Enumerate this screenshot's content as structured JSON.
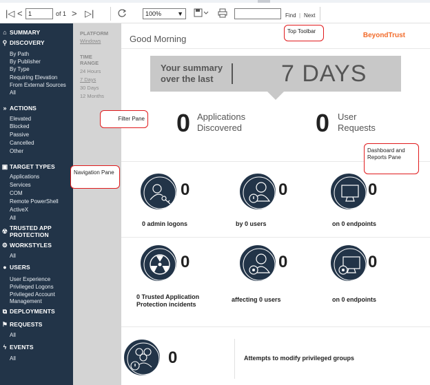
{
  "toolbar": {
    "first_page": "|◁",
    "prev_page": "<",
    "page_value": "1",
    "of_label": "of 1",
    "next_page": ">",
    "last_page": "▷|",
    "zoom_value": "100%",
    "find_label": "Find",
    "separator": "|",
    "next_label": "Next"
  },
  "sidebar": {
    "summary": "SUMMARY",
    "discovery": {
      "title": "DISCOVERY",
      "items": [
        "By Path",
        "By Publisher",
        "By Type",
        "Requiring Elevation",
        "From External Sources",
        "All"
      ]
    },
    "actions": {
      "title": "ACTIONS",
      "items": [
        "Elevated",
        "Blocked",
        "Passive",
        "Cancelled",
        "Other"
      ]
    },
    "target_types": {
      "title": "TARGET TYPES",
      "items": [
        "Applications",
        "Services",
        "COM",
        "Remote PowerShell",
        "ActiveX",
        "All"
      ]
    },
    "trusted_app": "TRUSTED APP PROTECTION",
    "workstyles": {
      "title": "WORKSTYLES",
      "items": [
        "All"
      ]
    },
    "users": {
      "title": "USERS",
      "items": [
        "User Experience",
        "Privileged Logons",
        "Privileged Account Management"
      ]
    },
    "deployments": "DEPLOYMENTS",
    "requests": {
      "title": "REQUESTS",
      "items": [
        "All"
      ]
    },
    "events": {
      "title": "EVENTS",
      "items": [
        "All"
      ]
    }
  },
  "filter": {
    "platform_label": "PLATFORM",
    "platform_value": "Windows",
    "time_range_label": "TIME RANGE",
    "time_options": [
      "24 Hours",
      "7 Days",
      "30 Days",
      "12 Months"
    ]
  },
  "main": {
    "greeting": "Good Morning",
    "brand": "BeyondTrust",
    "summary_label": "Your summary over the last",
    "summary_value": "7 DAYS",
    "apps_count": "0",
    "apps_label": "Applications Discovered",
    "requests_count": "0",
    "requests_label": "User Requests",
    "row1": [
      {
        "count": "0",
        "label": "0 admin logons"
      },
      {
        "count": "0",
        "label": "by 0 users"
      },
      {
        "count": "0",
        "label": "on 0 endpoints"
      }
    ],
    "row2": [
      {
        "count": "0",
        "label": "0 Trusted Application Protection incidents"
      },
      {
        "count": "0",
        "label": "affecting 0 users"
      },
      {
        "count": "0",
        "label": "on 0 endpoints"
      }
    ],
    "row3": {
      "count": "0",
      "label": "Attempts to modify privileged groups"
    }
  },
  "annotations": {
    "top_toolbar": "Top Toolbar",
    "filter_pane": "Filter Pane",
    "navigation_pane": "Navigation Pane",
    "dashboard_pane": "Dashboard and Reports Pane"
  },
  "colors": {
    "sidebar_bg": "#223448",
    "filter_bg": "#d4d4d4",
    "brand": "#f26b2a",
    "annotation_border": "#e0191b"
  }
}
